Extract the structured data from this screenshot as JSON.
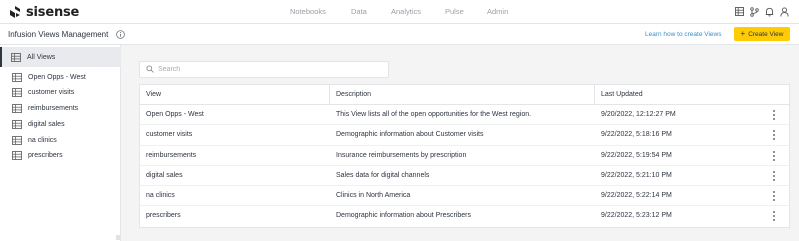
{
  "brand": {
    "name": "sisense",
    "accent": "#ffcb05",
    "link_color": "#3a8fc9"
  },
  "nav": {
    "items": [
      {
        "label": "Notebooks"
      },
      {
        "label": "Data"
      },
      {
        "label": "Analytics"
      },
      {
        "label": "Pulse"
      },
      {
        "label": "Admin"
      }
    ],
    "icons": [
      "grid-icon",
      "branch-icon",
      "bell-icon",
      "user-icon"
    ]
  },
  "header": {
    "title": "Infusion Views Management",
    "learn_link": "Learn how to create Views",
    "create_button": "Create View"
  },
  "sidebar": {
    "all_label": "All Views",
    "items": [
      {
        "label": "Open Opps - West"
      },
      {
        "label": "customer visits"
      },
      {
        "label": "reimbursements"
      },
      {
        "label": "digital sales"
      },
      {
        "label": "na clinics"
      },
      {
        "label": "prescribers"
      }
    ]
  },
  "search": {
    "placeholder": "Search",
    "value": ""
  },
  "table": {
    "columns": [
      "View",
      "Description",
      "Last Updated"
    ],
    "rows": [
      {
        "view": "Open Opps - West",
        "description": "This View lists all of the open opportunities for the West region.",
        "updated": "9/20/2022, 12:12:27 PM"
      },
      {
        "view": "customer visits",
        "description": "Demographic information about Customer visits",
        "updated": "9/22/2022, 5:18:16 PM"
      },
      {
        "view": "reimbursements",
        "description": "Insurance reimbursements by prescription",
        "updated": "9/22/2022, 5:19:54 PM"
      },
      {
        "view": "digital sales",
        "description": "Sales data for digital channels",
        "updated": "9/22/2022, 5:21:10 PM"
      },
      {
        "view": "na clinics",
        "description": "Clinics in North America",
        "updated": "9/22/2022, 5:22:14 PM"
      },
      {
        "view": "prescribers",
        "description": "Demographic information about Prescribers",
        "updated": "9/22/2022, 5:23:12 PM"
      }
    ]
  }
}
